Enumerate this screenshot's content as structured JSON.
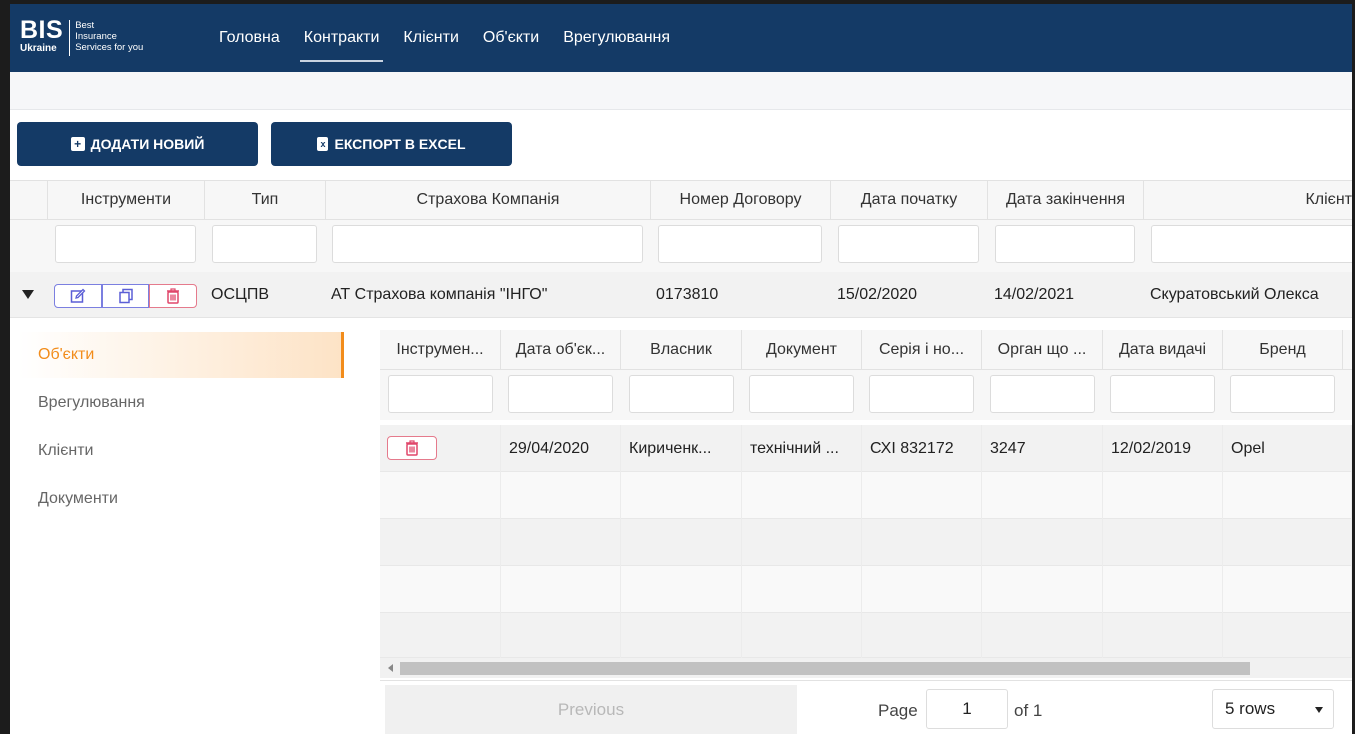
{
  "logo": {
    "big": "BIS",
    "small": "Ukraine",
    "tagline": [
      "Best",
      "Insurance",
      "Services for you"
    ]
  },
  "nav": [
    "Головна",
    "Контракти",
    "Клієнти",
    "Об'єкти",
    "Врегулювання"
  ],
  "buttons": {
    "add": "ДОДАТИ НОВИЙ",
    "export": "ЕКСПОРТ В EXCEL"
  },
  "outer_table": {
    "headers": [
      "Інструменти",
      "Тип",
      "Страхова Компанія",
      "Номер Договору",
      "Дата початку",
      "Дата закінчення",
      "Клієнт"
    ],
    "row": {
      "type": "ОСЦПВ",
      "company": "АТ Страхова компанія \"ІНГО\"",
      "number": "0173810",
      "start": "15/02/2020",
      "end": "14/02/2021",
      "client": "Скуратовський Олекса"
    }
  },
  "side_tabs": [
    "Об'єкти",
    "Врегулювання",
    "Клієнти",
    "Документи"
  ],
  "inner_table": {
    "headers": [
      "Інструмен...",
      "Дата об'єк...",
      "Власник",
      "Документ",
      "Серія і но...",
      "Орган що ...",
      "Дата видачі",
      "Бренд"
    ],
    "row": {
      "date": "29/04/2020",
      "owner": "Кириченк...",
      "document": "технічний ...",
      "series": "СХІ 832172",
      "organ": "3247",
      "issue_date": "12/02/2019",
      "brand": "Opel"
    }
  },
  "pager": {
    "previous": "Previous",
    "page_label": "Page",
    "page": "1",
    "of": "of 1",
    "rows": "5 rows"
  },
  "colors": {
    "navbar": "#143a66",
    "accent": "#f28c1a",
    "edit": "#7b7fe0",
    "delete": "#e57a8c"
  }
}
